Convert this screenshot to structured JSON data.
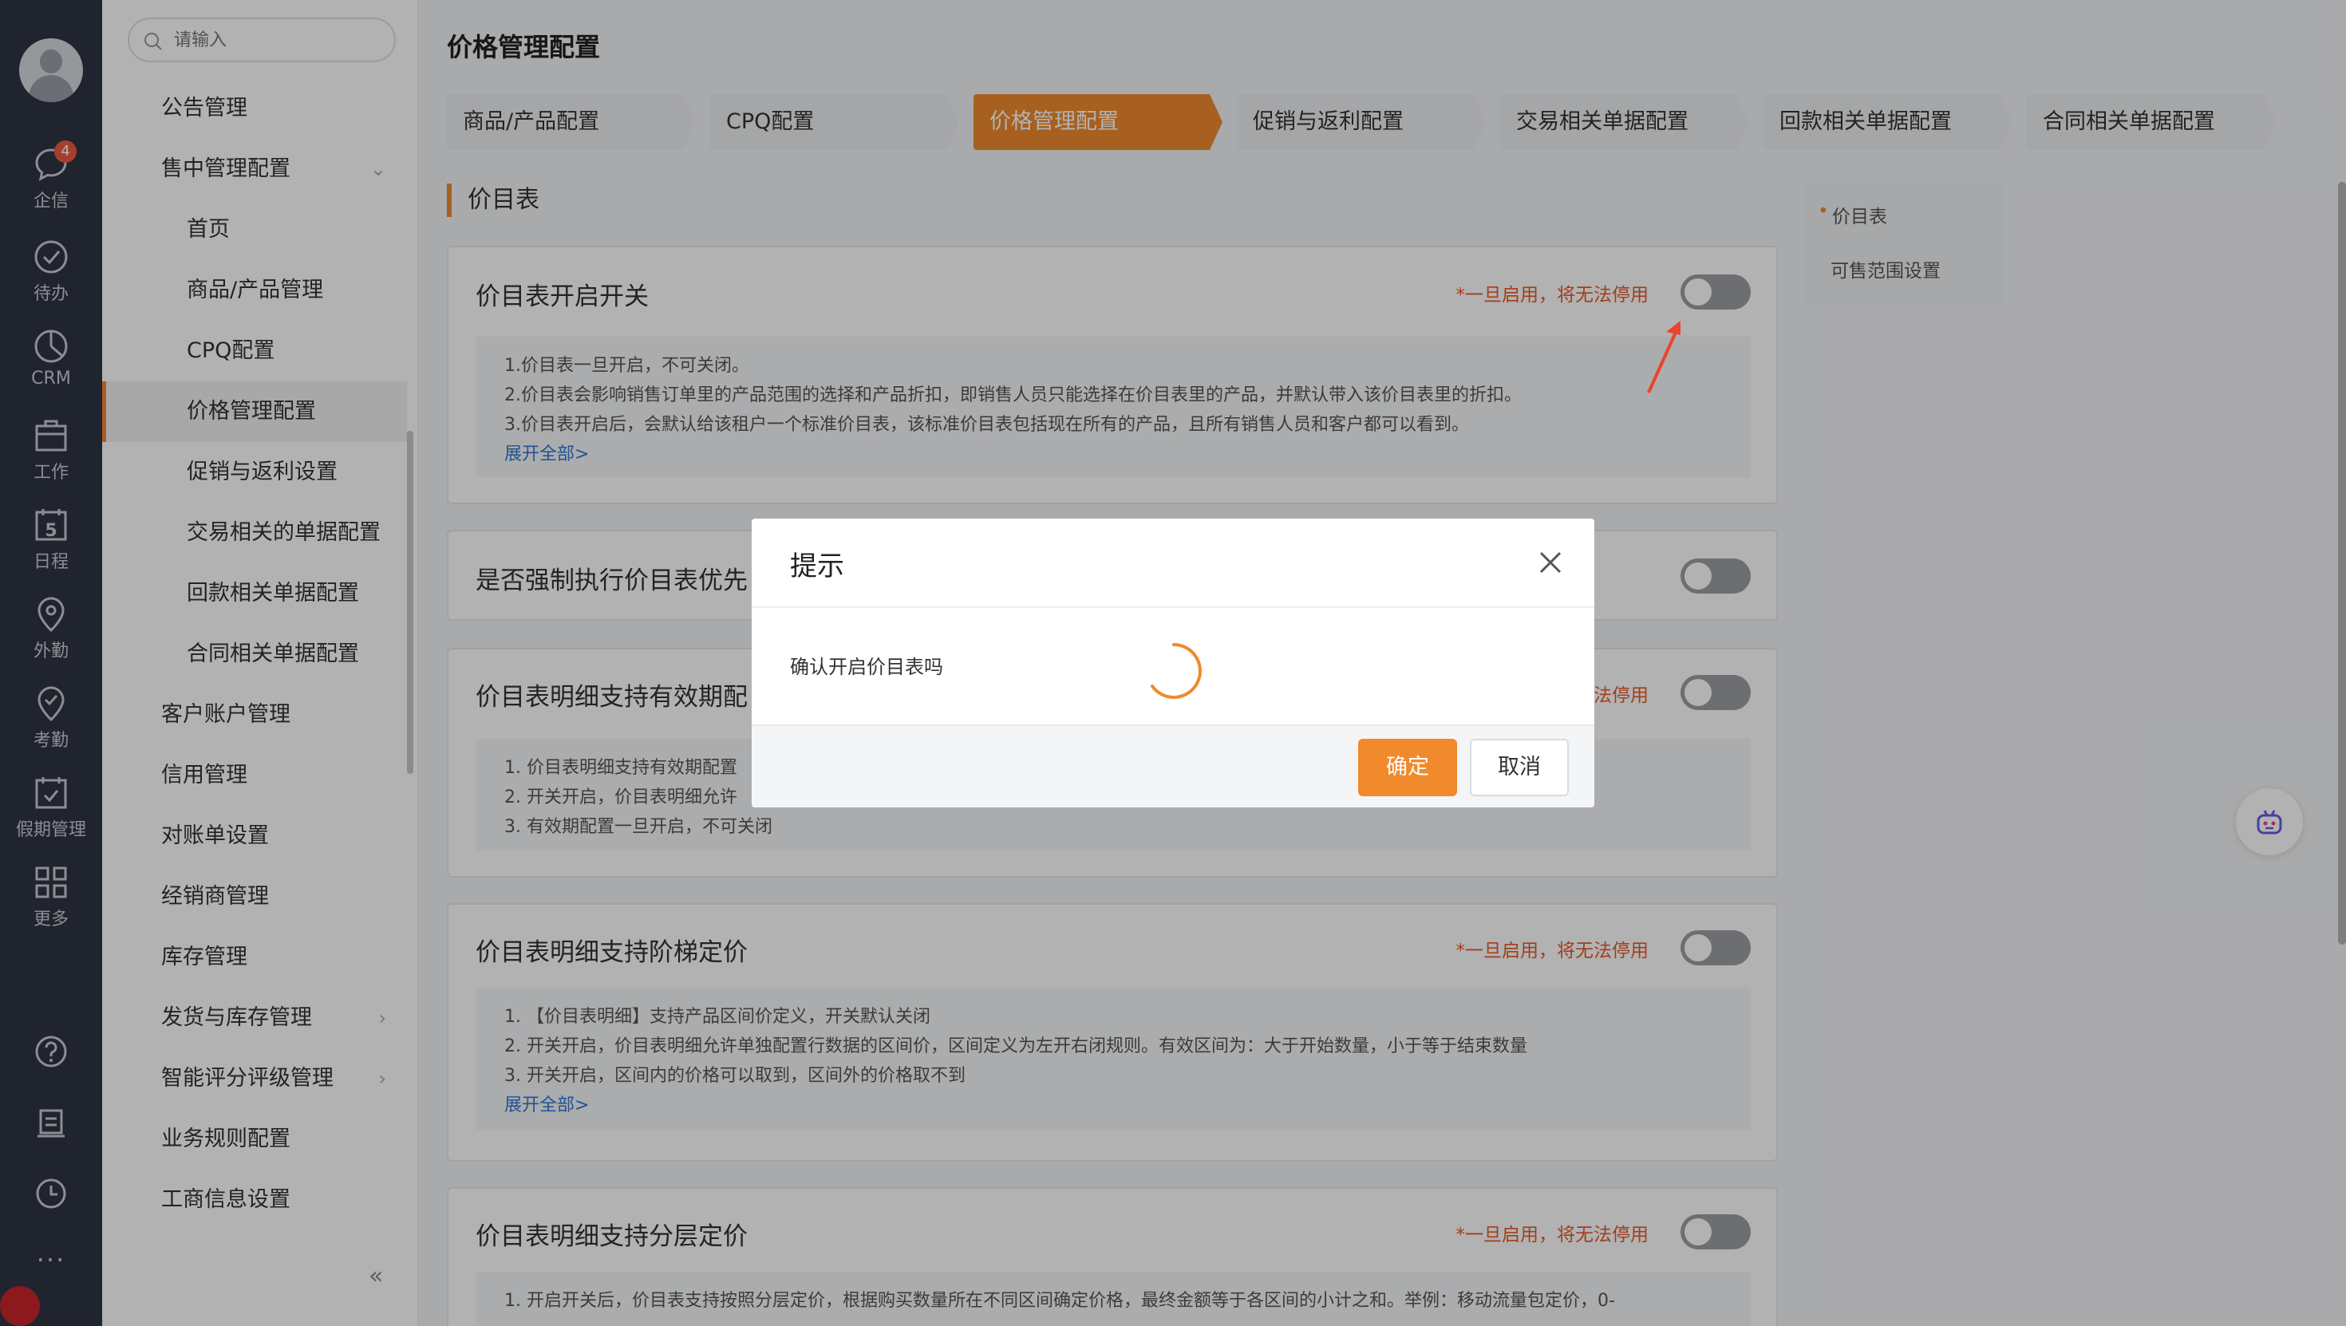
{
  "rail": {
    "items": [
      {
        "label": "企信",
        "badge": "4"
      },
      {
        "label": "待办"
      },
      {
        "label": "CRM"
      },
      {
        "label": "工作"
      },
      {
        "label": "日程",
        "glyph": "5"
      },
      {
        "label": "外勤"
      },
      {
        "label": "考勤"
      },
      {
        "label": "假期管理"
      },
      {
        "label": "更多"
      }
    ],
    "bottom_more": "···"
  },
  "nav": {
    "search_placeholder": "请输入",
    "items": [
      {
        "label": "公告管理",
        "level": 1
      },
      {
        "label": "售中管理配置",
        "level": 1,
        "expanded": true
      },
      {
        "label": "首页",
        "level": 2
      },
      {
        "label": "商品/产品管理",
        "level": 2
      },
      {
        "label": "CPQ配置",
        "level": 2
      },
      {
        "label": "价格管理配置",
        "level": 2,
        "active": true
      },
      {
        "label": "促销与返利设置",
        "level": 2
      },
      {
        "label": "交易相关的单据配置",
        "level": 2
      },
      {
        "label": "回款相关单据配置",
        "level": 2
      },
      {
        "label": "合同相关单据配置",
        "level": 2
      },
      {
        "label": "客户账户管理",
        "level": 1
      },
      {
        "label": "信用管理",
        "level": 1
      },
      {
        "label": "对账单设置",
        "level": 1
      },
      {
        "label": "经销商管理",
        "level": 1
      },
      {
        "label": "库存管理",
        "level": 1
      },
      {
        "label": "发货与库存管理",
        "level": 1,
        "has_children": true
      },
      {
        "label": "智能评分评级管理",
        "level": 1,
        "has_children": true
      },
      {
        "label": "业务规则配置",
        "level": 1
      },
      {
        "label": "工商信息设置",
        "level": 1
      }
    ],
    "collapse_glyph": "«"
  },
  "main": {
    "title": "价格管理配置",
    "tabs": [
      {
        "label": "商品/产品配置"
      },
      {
        "label": "CPQ配置"
      },
      {
        "label": "价格管理配置",
        "active": true
      },
      {
        "label": "促销与返利配置"
      },
      {
        "label": "交易相关单据配置"
      },
      {
        "label": "回款相关单据配置"
      },
      {
        "label": "合同相关单据配置"
      }
    ],
    "section_title": "价目表",
    "cards": [
      {
        "title": "价目表开启开关",
        "warning": "*一旦启用，将无法停用",
        "enabled": false,
        "lines": [
          "1.价目表一旦开启，不可关闭。",
          "2.价目表会影响销售订单里的产品范围的选择和产品折扣，即销售人员只能选择在价目表里的产品，并默认带入该价目表里的折扣。",
          "3.价目表开启后，会默认给该租户一个标准价目表，该标准价目表包括现在所有的产品，且所有销售人员和客户都可以看到。"
        ],
        "expand": "展开全部>"
      },
      {
        "title": "是否强制执行价目表优先",
        "enabled": false
      },
      {
        "title": "价目表明细支持有效期配",
        "warning": "法停用",
        "enabled": false,
        "lines": [
          "1. 价目表明细支持有效期配置",
          "2. 开关开启，价目表明细允许",
          "3. 有效期配置一旦开启，不可关闭"
        ]
      },
      {
        "title": "价目表明细支持阶梯定价",
        "warning": "*一旦启用，将无法停用",
        "enabled": false,
        "lines": [
          "1. 【价目表明细】支持产品区间价定义，开关默认关闭",
          "2. 开关开启，价目表明细允许单独配置行数据的区间价，区间定义为左开右闭规则。有效区间为：大于开始数量，小于等于结束数量",
          "3. 开关开启，区间内的价格可以取到，区间外的价格取不到"
        ],
        "expand": "展开全部>"
      },
      {
        "title": "价目表明细支持分层定价",
        "warning": "*一旦启用，将无法停用",
        "enabled": false,
        "lines": [
          "1. 开启开关后，价目表支持按照分层定价，根据购买数量所在不同区间确定价格，最终金额等于各区间的小计之和。举例：移动流量包定价，0-"
        ]
      }
    ],
    "anchors": [
      {
        "label": "价目表",
        "active": true
      },
      {
        "label": "可售范围设置"
      }
    ]
  },
  "dialog": {
    "title": "提示",
    "message": "确认开启价目表吗",
    "confirm": "确定",
    "cancel": "取消"
  },
  "colors": {
    "accent": "#ef8a2d",
    "rail": "#2e3442",
    "warning": "#e85a2a",
    "link": "#2f78d4"
  }
}
